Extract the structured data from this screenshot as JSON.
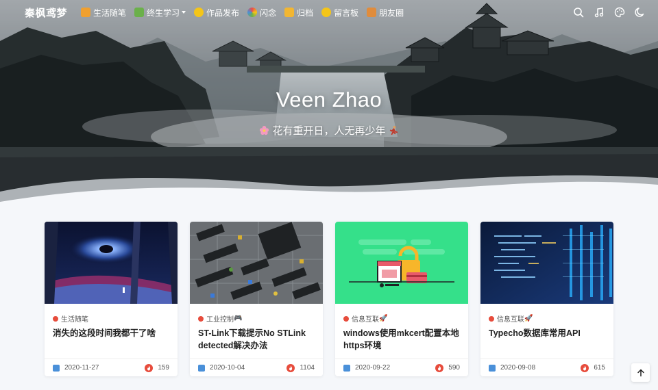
{
  "site": {
    "brand": "秦枫鸢梦"
  },
  "nav": {
    "items": [
      {
        "label": "生活随笔",
        "icon": "pudding-icon",
        "color": "#f0a030"
      },
      {
        "label": "终生学习",
        "icon": "books-icon",
        "color": "#6bb04b",
        "dropdown": true
      },
      {
        "label": "作品发布",
        "icon": "bulb-icon",
        "color": "#f5c518"
      },
      {
        "label": "闪念",
        "icon": "rainbow-icon",
        "color": "#e94c4c"
      },
      {
        "label": "归档",
        "icon": "folder-icon",
        "color": "#f2b632"
      },
      {
        "label": "留言板",
        "icon": "hand-icon",
        "color": "#f5c518"
      },
      {
        "label": "朋友圈",
        "icon": "sandwich-icon",
        "color": "#e08c3c"
      }
    ],
    "right_icons": [
      "search-icon",
      "music-icon",
      "palette-icon",
      "moon-icon"
    ]
  },
  "hero": {
    "title": "Veen Zhao",
    "subtitle": "花有重开日，人无再少年"
  },
  "posts": [
    {
      "category": "生活随笔",
      "category_emoji": "",
      "title": "消失的这段时间我都干了啥",
      "date": "2020-11-27",
      "views": "159",
      "thumb": "space-window"
    },
    {
      "category": "工业控制",
      "category_emoji": "🎮",
      "title": "ST-Link下载提示No STLink detected解决办法",
      "date": "2020-10-04",
      "views": "1104",
      "thumb": "circuit-board"
    },
    {
      "category": "信息互联",
      "category_emoji": "🚀",
      "title": "windows使用mkcert配置本地https环境",
      "date": "2020-09-22",
      "views": "590",
      "thumb": "ssl-lock"
    },
    {
      "category": "信息互联",
      "category_emoji": "🚀",
      "title": "Typecho数据库常用API",
      "date": "2020-09-08",
      "views": "615",
      "thumb": "code-screen"
    }
  ],
  "colors": {
    "accent": "#e74c3c",
    "date_icon": "#4a90d9",
    "page_bg": "#f5f7fa"
  }
}
